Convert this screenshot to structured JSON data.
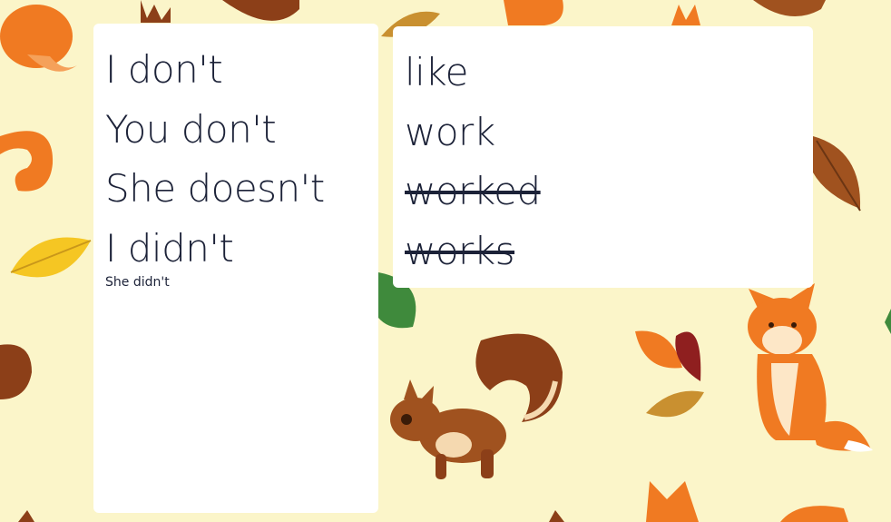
{
  "left_card": {
    "items": [
      "I don't",
      "You don't",
      "She doesn't",
      "I didn't"
    ],
    "hint": "She didn't"
  },
  "right_card": {
    "items": [
      {
        "text": "like",
        "struck": false
      },
      {
        "text": "work",
        "struck": false
      },
      {
        "text": "worked",
        "struck": true
      },
      {
        "text": "works",
        "struck": true
      }
    ]
  },
  "colors": {
    "background": "#fbf5c9",
    "text": "#1c2238",
    "fox": "#f07a22",
    "squirrel": "#a0521f",
    "leaf_yellow": "#f5c623",
    "leaf_green": "#3f8a3c",
    "leaf_red": "#8f1f1f"
  },
  "icons": [
    "squirrel-icon",
    "fox-icon",
    "leaf-icon"
  ]
}
